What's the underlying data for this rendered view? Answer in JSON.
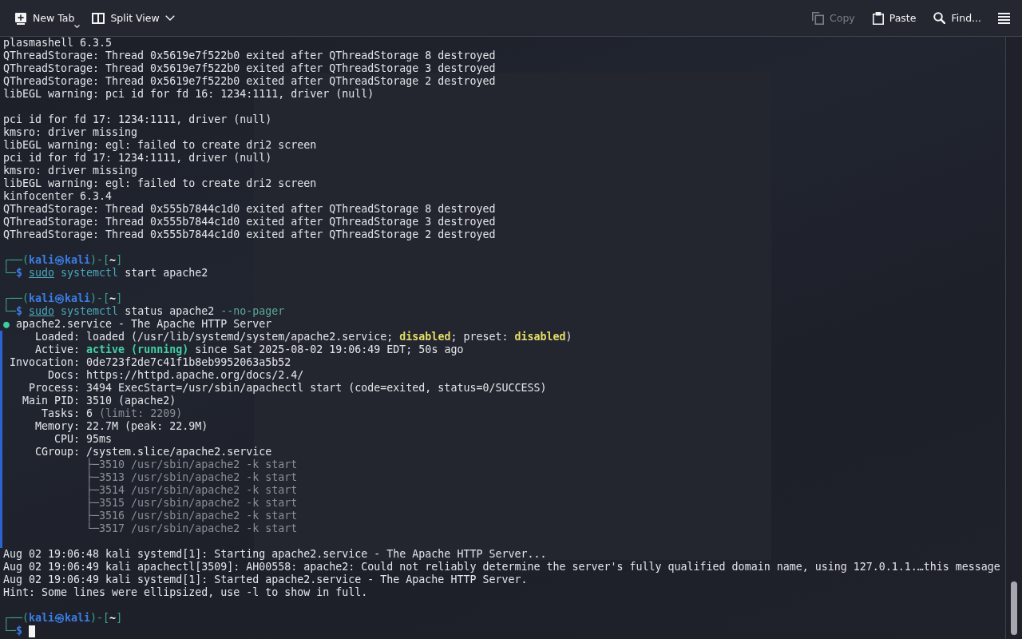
{
  "toolbar": {
    "left_actions": [
      {
        "kind": "new-tab",
        "label": "New Tab",
        "disabled": false,
        "menu": true
      },
      {
        "kind": "split-view",
        "label": "Split View",
        "disabled": false,
        "menu": true
      }
    ],
    "right_actions": [
      {
        "kind": "copy",
        "label": "Copy",
        "disabled": true,
        "menu": false
      },
      {
        "kind": "paste",
        "label": "Paste",
        "disabled": false,
        "menu": false
      },
      {
        "kind": "find",
        "label": "Find...",
        "disabled": false,
        "menu": false
      }
    ]
  },
  "terminal": {
    "blocks": [
      {
        "marked": false,
        "lines": [
          {
            "kind": "text",
            "segments": [
              {
                "kind": "plain",
                "text": "plasmashell 6.3.5"
              }
            ]
          },
          {
            "kind": "text",
            "segments": [
              {
                "kind": "plain",
                "text": "QThreadStorage: Thread 0x5619e7f522b0 exited after QThreadStorage 8 destroyed"
              }
            ]
          },
          {
            "kind": "text",
            "segments": [
              {
                "kind": "plain",
                "text": "QThreadStorage: Thread 0x5619e7f522b0 exited after QThreadStorage 3 destroyed"
              }
            ]
          },
          {
            "kind": "text",
            "segments": [
              {
                "kind": "plain",
                "text": "QThreadStorage: Thread 0x5619e7f522b0 exited after QThreadStorage 2 destroyed"
              }
            ]
          },
          {
            "kind": "text",
            "segments": [
              {
                "kind": "plain",
                "text": "libEGL warning: pci id for fd 16: 1234:1111, driver (null)"
              }
            ]
          },
          {
            "kind": "blank"
          },
          {
            "kind": "text",
            "segments": [
              {
                "kind": "plain",
                "text": "pci id for fd 17: 1234:1111, driver (null)"
              }
            ]
          },
          {
            "kind": "text",
            "segments": [
              {
                "kind": "plain",
                "text": "kmsro: driver missing"
              }
            ]
          },
          {
            "kind": "text",
            "segments": [
              {
                "kind": "plain",
                "text": "libEGL warning: egl: failed to create dri2 screen"
              }
            ]
          },
          {
            "kind": "text",
            "segments": [
              {
                "kind": "plain",
                "text": "pci id for fd 17: 1234:1111, driver (null)"
              }
            ]
          },
          {
            "kind": "text",
            "segments": [
              {
                "kind": "plain",
                "text": "kmsro: driver missing"
              }
            ]
          },
          {
            "kind": "text",
            "segments": [
              {
                "kind": "plain",
                "text": "libEGL warning: egl: failed to create dri2 screen"
              }
            ]
          },
          {
            "kind": "text",
            "segments": [
              {
                "kind": "plain",
                "text": "kinfocenter 6.3.4"
              }
            ]
          },
          {
            "kind": "text",
            "segments": [
              {
                "kind": "plain",
                "text": "QThreadStorage: Thread 0x555b7844c1d0 exited after QThreadStorage 8 destroyed"
              }
            ]
          },
          {
            "kind": "text",
            "segments": [
              {
                "kind": "plain",
                "text": "QThreadStorage: Thread 0x555b7844c1d0 exited after QThreadStorage 3 destroyed"
              }
            ]
          },
          {
            "kind": "text",
            "segments": [
              {
                "kind": "plain",
                "text": "QThreadStorage: Thread 0x555b7844c1d0 exited after QThreadStorage 2 destroyed"
              }
            ]
          },
          {
            "kind": "blank"
          },
          {
            "kind": "text",
            "segments": [
              {
                "kind": "frame",
                "text": "┌──("
              },
              {
                "kind": "user",
                "text": "kali㉿kali"
              },
              {
                "kind": "frame",
                "text": ")-["
              },
              {
                "kind": "dir",
                "text": "~"
              },
              {
                "kind": "frame",
                "text": "]"
              }
            ]
          },
          {
            "kind": "text",
            "segments": [
              {
                "kind": "frame",
                "text": "└─"
              },
              {
                "kind": "dollar",
                "text": "$ "
              },
              {
                "kind": "precommand",
                "text": "sudo"
              },
              {
                "kind": "command",
                "text": " systemctl"
              },
              {
                "kind": "plain",
                "text": " start apache2"
              }
            ]
          },
          {
            "kind": "blank"
          },
          {
            "kind": "text",
            "segments": [
              {
                "kind": "frame",
                "text": "┌──("
              },
              {
                "kind": "user",
                "text": "kali㉿kali"
              },
              {
                "kind": "frame",
                "text": ")-["
              },
              {
                "kind": "dir",
                "text": "~"
              },
              {
                "kind": "frame",
                "text": "]"
              }
            ]
          },
          {
            "kind": "text",
            "segments": [
              {
                "kind": "frame",
                "text": "└─"
              },
              {
                "kind": "dollar",
                "text": "$ "
              },
              {
                "kind": "precommand",
                "text": "sudo"
              },
              {
                "kind": "command",
                "text": " systemctl"
              },
              {
                "kind": "plain",
                "text": " status apache2"
              },
              {
                "kind": "option",
                "text": " --no-pager"
              }
            ]
          },
          {
            "kind": "text",
            "segments": [
              {
                "kind": "ok",
                "text": "●"
              },
              {
                "kind": "plain",
                "text": " apache2.service - The Apache HTTP Server"
              }
            ]
          }
        ]
      },
      {
        "marked": true,
        "lines": [
          {
            "kind": "text",
            "segments": [
              {
                "kind": "plain",
                "text": "     Loaded: loaded (/usr/lib/systemd/system/apache2.service; "
              },
              {
                "kind": "warn",
                "text": "disabled"
              },
              {
                "kind": "plain",
                "text": "; preset: "
              },
              {
                "kind": "warn",
                "text": "disabled"
              },
              {
                "kind": "plain",
                "text": ")"
              }
            ]
          },
          {
            "kind": "text",
            "segments": [
              {
                "kind": "plain",
                "text": "     Active: "
              },
              {
                "kind": "active",
                "text": "active (running)"
              },
              {
                "kind": "plain",
                "text": " since Sat 2025-08-02 19:06:49 EDT; 50s ago"
              }
            ]
          },
          {
            "kind": "text",
            "segments": [
              {
                "kind": "plain",
                "text": " Invocation: 0de723f2de7c41f1b8eb9952063a5b52"
              }
            ]
          },
          {
            "kind": "text",
            "segments": [
              {
                "kind": "plain",
                "text": "       Docs: https://httpd.apache.org/docs/2.4/"
              }
            ]
          },
          {
            "kind": "text",
            "segments": [
              {
                "kind": "plain",
                "text": "    Process: 3494 ExecStart=/usr/sbin/apachectl start (code=exited, status=0/SUCCESS)"
              }
            ]
          },
          {
            "kind": "text",
            "segments": [
              {
                "kind": "plain",
                "text": "   Main PID: 3510 (apache2)"
              }
            ]
          },
          {
            "kind": "text",
            "segments": [
              {
                "kind": "plain",
                "text": "      Tasks: 6 "
              },
              {
                "kind": "dim",
                "text": "(limit: 2209)"
              }
            ]
          },
          {
            "kind": "text",
            "segments": [
              {
                "kind": "plain",
                "text": "     Memory: 22.7M (peak: 22.9M)"
              }
            ]
          },
          {
            "kind": "text",
            "segments": [
              {
                "kind": "plain",
                "text": "        CPU: 95ms"
              }
            ]
          },
          {
            "kind": "text",
            "segments": [
              {
                "kind": "plain",
                "text": "     CGroup: /system.slice/apache2.service"
              }
            ]
          },
          {
            "kind": "text",
            "segments": [
              {
                "kind": "dim",
                "text": "             ├─3510 /usr/sbin/apache2 -k start"
              }
            ]
          },
          {
            "kind": "text",
            "segments": [
              {
                "kind": "dim",
                "text": "             ├─3513 /usr/sbin/apache2 -k start"
              }
            ]
          },
          {
            "kind": "text",
            "segments": [
              {
                "kind": "dim",
                "text": "             ├─3514 /usr/sbin/apache2 -k start"
              }
            ]
          },
          {
            "kind": "text",
            "segments": [
              {
                "kind": "dim",
                "text": "             ├─3515 /usr/sbin/apache2 -k start"
              }
            ]
          },
          {
            "kind": "text",
            "segments": [
              {
                "kind": "dim",
                "text": "             ├─3516 /usr/sbin/apache2 -k start"
              }
            ]
          },
          {
            "kind": "text",
            "segments": [
              {
                "kind": "dim",
                "text": "             └─3517 /usr/sbin/apache2 -k start"
              }
            ]
          },
          {
            "kind": "blank"
          }
        ]
      },
      {
        "marked": false,
        "lines": [
          {
            "kind": "text",
            "segments": [
              {
                "kind": "plain",
                "text": "Aug 02 19:06:48 kali systemd[1]: Starting apache2.service - The Apache HTTP Server..."
              }
            ]
          },
          {
            "kind": "text",
            "segments": [
              {
                "kind": "plain",
                "text": "Aug 02 19:06:49 kali apachectl[3509]: AH00558: apache2: Could not reliably determine the server's fully qualified domain name, using 127.0.1.1.…this message"
              }
            ]
          },
          {
            "kind": "text",
            "segments": [
              {
                "kind": "plain",
                "text": "Aug 02 19:06:49 kali systemd[1]: Started apache2.service - The Apache HTTP Server."
              }
            ]
          },
          {
            "kind": "text",
            "segments": [
              {
                "kind": "plain",
                "text": "Hint: Some lines were ellipsized, use -l to show in full."
              }
            ]
          },
          {
            "kind": "blank"
          },
          {
            "kind": "text",
            "segments": [
              {
                "kind": "frame",
                "text": "┌──("
              },
              {
                "kind": "user",
                "text": "kali㉿kali"
              },
              {
                "kind": "frame",
                "text": ")-["
              },
              {
                "kind": "dir",
                "text": "~"
              },
              {
                "kind": "frame",
                "text": "]"
              }
            ]
          },
          {
            "kind": "input",
            "segments": [
              {
                "kind": "frame",
                "text": "└─"
              },
              {
                "kind": "dollar",
                "text": "$"
              }
            ]
          }
        ]
      }
    ]
  }
}
